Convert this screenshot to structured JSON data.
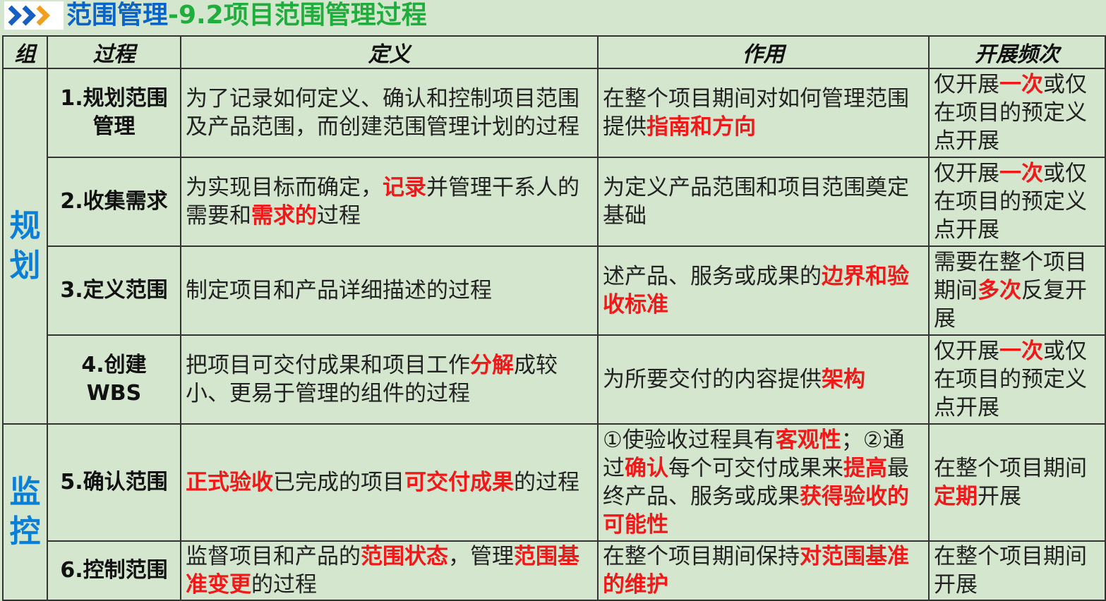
{
  "title": {
    "part1": "范围管理",
    "part2": "-9.2项目范围管理过程"
  },
  "icon": "triple-chevron-right-icon",
  "colors": {
    "accent_blue": "#0a7fd8",
    "highlight_red": "#f01818",
    "title_green": "#1fae3c",
    "background": "#d5e6cf"
  },
  "headers": {
    "group": "组",
    "process": "过程",
    "definition": "定义",
    "role": "作用",
    "frequency": "开展频次"
  },
  "groups": {
    "planning": "规划",
    "monitoring": "监控"
  },
  "rows": [
    {
      "process": [
        "1.规划范围",
        "管理"
      ],
      "definition": [
        {
          "t": "为了记录如何定义、确认和控制项目范围及产品范围，而创建范围管理计划的过程",
          "r": false
        }
      ],
      "role": [
        {
          "t": "在整个项目期间对如何管理范围提供",
          "r": false
        },
        {
          "t": "指南和方向",
          "r": true
        }
      ],
      "frequency": [
        {
          "t": "仅开展",
          "r": false
        },
        {
          "t": "一次",
          "r": true
        },
        {
          "t": "或仅在项目的预定义点开展",
          "r": false
        }
      ]
    },
    {
      "process": [
        "2.收集需求"
      ],
      "definition": [
        {
          "t": "为实现目标而确定，",
          "r": false
        },
        {
          "t": "记录",
          "r": true
        },
        {
          "t": "并管理干系人的需要和",
          "r": false
        },
        {
          "t": "需求的",
          "r": true
        },
        {
          "t": "过程",
          "r": false
        }
      ],
      "role": [
        {
          "t": "为定义产品范围和项目范围奠定基础",
          "r": false
        }
      ],
      "frequency": [
        {
          "t": "仅开展",
          "r": false
        },
        {
          "t": "一次",
          "r": true
        },
        {
          "t": "或仅在项目的预定义点开展",
          "r": false
        }
      ]
    },
    {
      "process": [
        "3.定义范围"
      ],
      "definition": [
        {
          "t": "制定项目和产品详细描述的过程",
          "r": false
        }
      ],
      "role": [
        {
          "t": "述产品、服务或成果的",
          "r": false
        },
        {
          "t": "边界和验收标准",
          "r": true
        }
      ],
      "frequency": [
        {
          "t": "需要在整个项目期间",
          "r": false
        },
        {
          "t": "多次",
          "r": true
        },
        {
          "t": "反复开展",
          "r": false
        }
      ]
    },
    {
      "process": [
        "4.创建",
        "WBS"
      ],
      "definition": [
        {
          "t": "把项目可交付成果和项目工作",
          "r": false
        },
        {
          "t": "分解",
          "r": true
        },
        {
          "t": "成较小、更易于管理的组件的过程",
          "r": false
        }
      ],
      "role": [
        {
          "t": "为所要交付的内容提供",
          "r": false
        },
        {
          "t": "架构",
          "r": true
        }
      ],
      "frequency": [
        {
          "t": "仅开展",
          "r": false
        },
        {
          "t": "一次",
          "r": true
        },
        {
          "t": "或仅在项目的预定义点开展",
          "r": false
        }
      ]
    },
    {
      "process": [
        "5.确认范围"
      ],
      "definition": [
        {
          "t": "正式验收",
          "r": true
        },
        {
          "t": "已完成的项目",
          "r": false
        },
        {
          "t": "可交付成果",
          "r": true
        },
        {
          "t": "的过程",
          "r": false
        }
      ],
      "role": [
        {
          "t": "①使验收过程具有",
          "r": false
        },
        {
          "t": "客观性",
          "r": true
        },
        {
          "t": "；②通过",
          "r": false
        },
        {
          "t": "确认",
          "r": true
        },
        {
          "t": "每个可交付成果来",
          "r": false
        },
        {
          "t": "提高",
          "r": true
        },
        {
          "t": "最终产品、服务或成果",
          "r": false
        },
        {
          "t": "获得验收的可能性",
          "r": true
        }
      ],
      "frequency": [
        {
          "t": "在整个项目期间",
          "r": false
        },
        {
          "t": "定期",
          "r": true
        },
        {
          "t": "开展",
          "r": false
        }
      ]
    },
    {
      "process": [
        "6.控制范围"
      ],
      "definition": [
        {
          "t": "监督项目和产品的",
          "r": false
        },
        {
          "t": "范围状态",
          "r": true
        },
        {
          "t": "，管理",
          "r": false
        },
        {
          "t": "范围基准变更",
          "r": true
        },
        {
          "t": "的过程",
          "r": false
        }
      ],
      "role": [
        {
          "t": "在整个项目期间保持",
          "r": false
        },
        {
          "t": "对范围基准的维护",
          "r": true
        }
      ],
      "frequency": [
        {
          "t": "在整个项目期间开展",
          "r": false
        }
      ]
    }
  ]
}
